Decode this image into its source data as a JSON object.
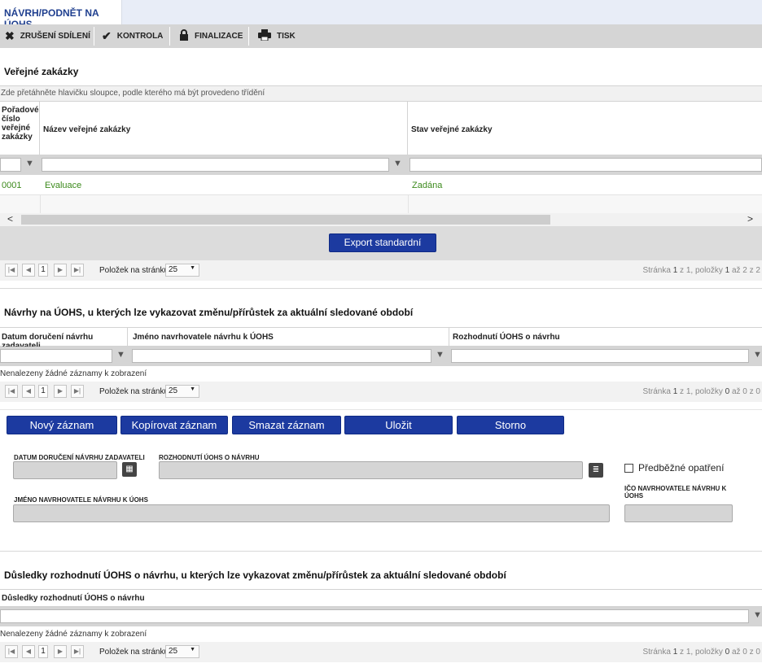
{
  "tab": {
    "label": "NÁVRH/PODNĚT NA ÚOHS"
  },
  "toolbar": {
    "cancel_share": "ZRUŠENÍ SDÍLENÍ",
    "check": "KONTROLA",
    "finalize": "FINALIZACE",
    "print": "TISK"
  },
  "public_contracts": {
    "title": "Veřejné zakázky",
    "group_hint": "Zde přetáhněte hlavičku sloupce, podle kterého má být provedeno třídění",
    "columns": [
      "Pořadové číslo veřejné zakázky",
      "Název veřejné zakázky",
      "Stav veřejné zakázky"
    ],
    "rows": [
      {
        "number": "0001",
        "name": "Evaluace",
        "state": "Zadána"
      }
    ],
    "export_label": "Export standardní",
    "pager": {
      "page": "1",
      "per_page_label": "Položek na stránku",
      "per_page": "25",
      "info_prefix": "Stránka ",
      "info_page": "1",
      "info_mid": " z 1, položky ",
      "info_from": "1",
      "info_to_text": " až 2 z 2"
    }
  },
  "proposals": {
    "title": "Návrhy na ÚOHS, u kterých lze vykazovat změnu/přírůstek za aktuální sledované období",
    "columns": [
      "Datum doručení návrhu zadavateli",
      "Jméno navrhovatele návrhu k ÚOHS",
      "Rozhodnutí ÚOHS o návrhu"
    ],
    "empty_text": "Nenalezeny žádné záznamy k zobrazení",
    "pager": {
      "page": "1",
      "per_page_label": "Položek na stránku",
      "per_page": "25",
      "info_prefix": "Stránka ",
      "info_page": "1",
      "info_mid": " z 1, položky ",
      "info_from": "0",
      "info_to_text": " až 0 z 0"
    }
  },
  "actions": {
    "new": "Nový záznam",
    "copy": "Kopírovat záznam",
    "delete": "Smazat záznam",
    "save": "Uložit",
    "cancel": "Storno"
  },
  "form": {
    "delivery_date_label": "DATUM DORUČENÍ NÁVRHU ZADAVATELI",
    "decision_label": "ROZHODNUTÍ ÚOHS O NÁVRHU",
    "preliminary_label": "Předběžné opatření",
    "proposer_name_label": "JMÉNO NAVRHOVATELE NÁVRHU K ÚOHS",
    "proposer_ico_label": "IČO NAVRHOVATELE NÁVRHU K ÚOHS"
  },
  "consequences": {
    "title": "Důsledky rozhodnutí ÚOHS o návrhu, u kterých lze vykazovat změnu/přírůstek za aktuální sledované období",
    "columns": [
      "Důsledky rozhodnutí ÚOHS o návrhu"
    ],
    "empty_text": "Nenalezeny žádné záznamy k zobrazení",
    "pager": {
      "page": "1",
      "per_page_label": "Položek na stránku",
      "per_page": "25",
      "info_prefix": "Stránka ",
      "info_page": "1",
      "info_mid": " z 1, položky ",
      "info_from": "0",
      "info_to_text": " až 0 z 0"
    }
  },
  "icons": {
    "first": "first-page-icon",
    "prev": "prev-page-icon",
    "next": "next-page-icon",
    "last": "last-page-icon",
    "filter": "filter-icon",
    "calendar": "calendar-icon",
    "list": "list-icon"
  },
  "colors": {
    "accent_blue": "#1c3aa0",
    "link_green": "#3c8a1c",
    "toolbar_gray": "#d5d5d5"
  }
}
